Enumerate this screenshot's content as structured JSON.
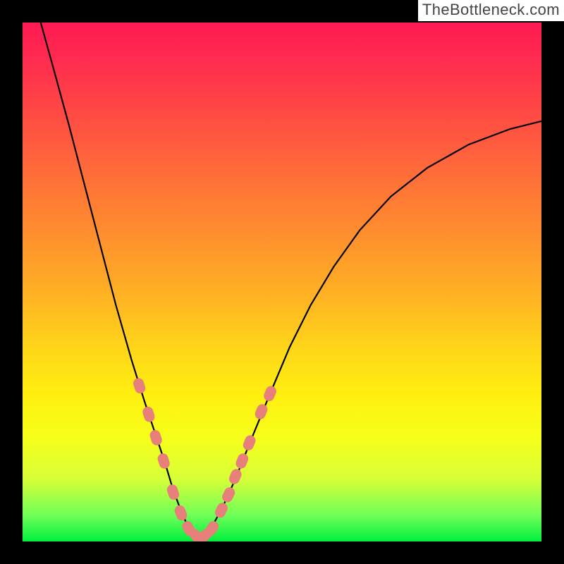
{
  "watermark": "TheBottleneck.com",
  "colors": {
    "frame": "#000000",
    "curve": "#000000",
    "marker": "#e77f7a",
    "gradient_top": "#ff1a53",
    "gradient_bottom": "#00ef3e"
  },
  "chart_data": {
    "type": "line",
    "title": "",
    "xlabel": "",
    "ylabel": "",
    "xlim": [
      0,
      100
    ],
    "ylim": [
      0,
      100
    ],
    "axes_visible": false,
    "grid": false,
    "note": "Axes are not rendered; values inferred proportionally from pixel positions (0 = bottom/left, 100 = top/right).",
    "series": [
      {
        "name": "curve",
        "x": [
          3.5,
          6,
          9,
          12,
          15,
          18,
          21,
          23.5,
          25.5,
          27.5,
          29,
          30.5,
          31.8,
          33,
          34,
          35.2,
          36.6,
          38.5,
          41,
          44,
          47.5,
          51.5,
          55.5,
          60,
          65,
          71,
          78,
          86,
          94,
          100
        ],
        "y": [
          100,
          91,
          80,
          68.5,
          57,
          45.5,
          35,
          27,
          21,
          15,
          10,
          6,
          3,
          1.2,
          0.4,
          1.2,
          3,
          6.5,
          12,
          19.5,
          28,
          37.5,
          45.5,
          53,
          60,
          66.5,
          72,
          76.5,
          79.5,
          81
        ]
      }
    ],
    "markers": {
      "name": "highlighted-points",
      "shape": "capsule",
      "color": "#e77f7a",
      "x": [
        22.5,
        24.3,
        25.7,
        27.2,
        29.0,
        30.5,
        32.0,
        33.5,
        35.0,
        36.5,
        38.3,
        39.7,
        41.0,
        42.3,
        43.7,
        46.0,
        47.7
      ],
      "y": [
        30.0,
        24.5,
        20.0,
        15.5,
        9.5,
        5.5,
        2.5,
        1.0,
        1.0,
        2.5,
        6.0,
        9.0,
        12.5,
        15.5,
        19.0,
        25.0,
        28.5
      ]
    }
  }
}
